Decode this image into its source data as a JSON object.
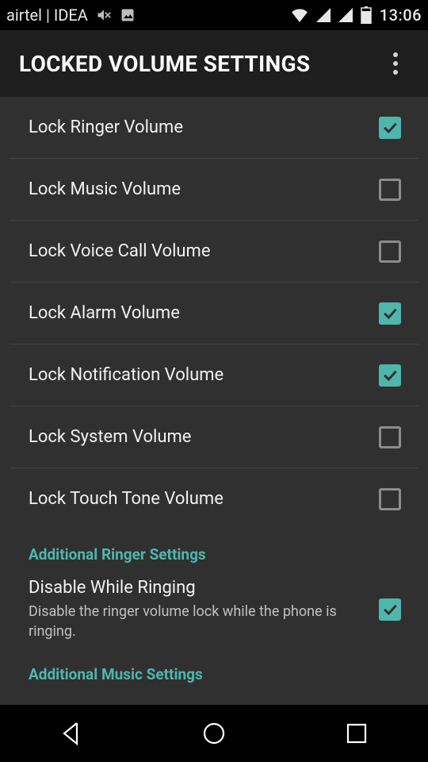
{
  "statusbar": {
    "carrier": "airtel | IDEA",
    "clock": "13:06"
  },
  "appbar": {
    "title": "LOCKED VOLUME SETTINGS"
  },
  "settings": [
    {
      "label": "Lock Ringer Volume",
      "checked": true
    },
    {
      "label": "Lock Music Volume",
      "checked": false
    },
    {
      "label": "Lock Voice Call Volume",
      "checked": false
    },
    {
      "label": "Lock Alarm Volume",
      "checked": true
    },
    {
      "label": "Lock Notification Volume",
      "checked": true
    },
    {
      "label": "Lock System Volume",
      "checked": false
    },
    {
      "label": "Lock Touch Tone Volume",
      "checked": false
    }
  ],
  "section_ringer": "Additional Ringer Settings",
  "ringer_row": {
    "label": "Disable While Ringing",
    "sublabel": "Disable the ringer volume lock while the phone is ringing.",
    "checked": true
  },
  "section_music": "Additional Music Settings",
  "colors": {
    "accent": "#4fb6ac",
    "bg": "#303030"
  }
}
